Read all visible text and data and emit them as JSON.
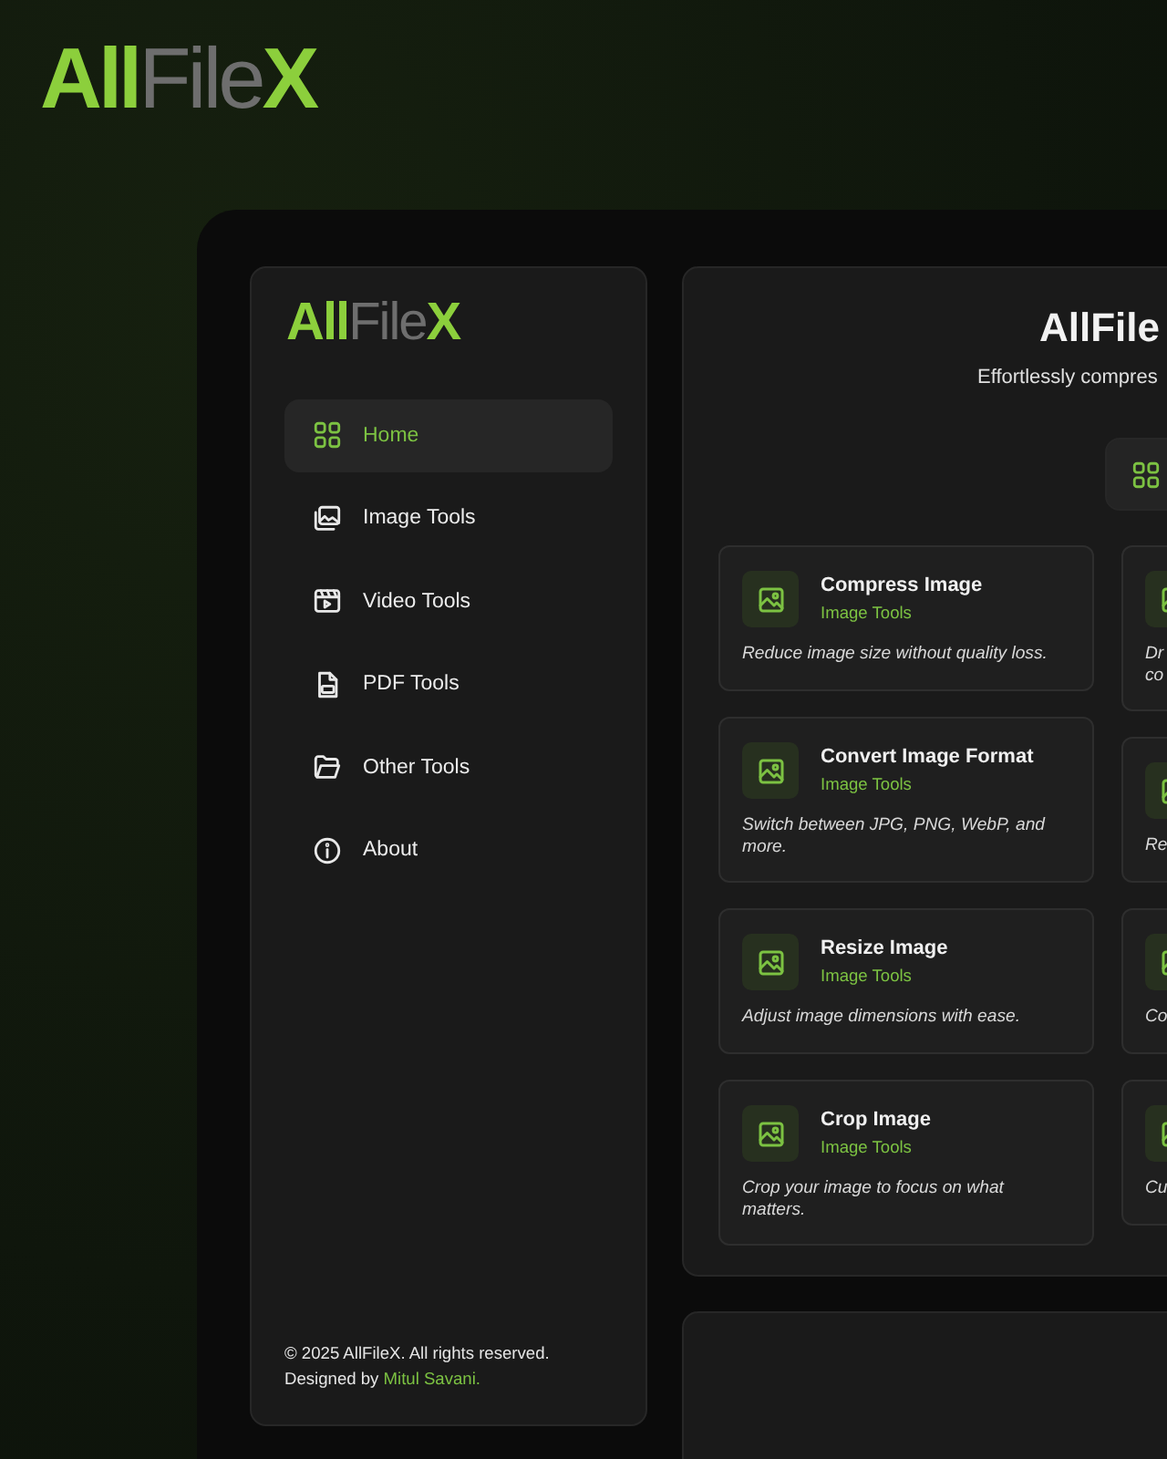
{
  "brand": {
    "logo": [
      {
        "text": "All",
        "accent": true
      },
      {
        "text": "File",
        "accent": false
      },
      {
        "text": "X",
        "accent": true
      }
    ]
  },
  "sidebar": {
    "logo": [
      {
        "text": "All",
        "accent": true
      },
      {
        "text": "File",
        "accent": false
      },
      {
        "text": "X",
        "accent": true
      }
    ],
    "items": [
      {
        "label": "Home",
        "kind": "grid",
        "selected": true
      },
      {
        "label": "Image Tools",
        "kind": "images",
        "selected": false
      },
      {
        "label": "Video Tools",
        "kind": "video",
        "selected": false
      },
      {
        "label": "PDF Tools",
        "kind": "pdf",
        "selected": false
      },
      {
        "label": "Other Tools",
        "kind": "folder",
        "selected": false
      },
      {
        "label": "About",
        "kind": "info",
        "selected": false
      }
    ],
    "footer": {
      "copyright": "© 2025 AllFileX. All rights reserved.",
      "designed_by": "Designed by",
      "author": "Mitul Savani."
    }
  },
  "main": {
    "title": "AllFile",
    "subtitle": "Effortlessly compres",
    "tabs": [
      {
        "kind": "grid",
        "selected": true
      }
    ],
    "column_1": [
      {
        "title": "Compress Image",
        "category": "Image Tools",
        "description": "Reduce image size without quality loss."
      },
      {
        "title": "Convert Image Format",
        "category": "Image Tools",
        "description": "Switch between JPG, PNG, WebP, and more."
      },
      {
        "title": "Resize Image",
        "category": "Image Tools",
        "description": "Adjust image dimensions with ease."
      },
      {
        "title": "Crop Image",
        "category": "Image Tools",
        "description": "Crop your image to focus on what matters."
      }
    ],
    "column_2": [
      {
        "description": "Dr co"
      },
      {
        "description": "Re"
      },
      {
        "description": "Co"
      },
      {
        "description": "Cu"
      }
    ]
  }
}
